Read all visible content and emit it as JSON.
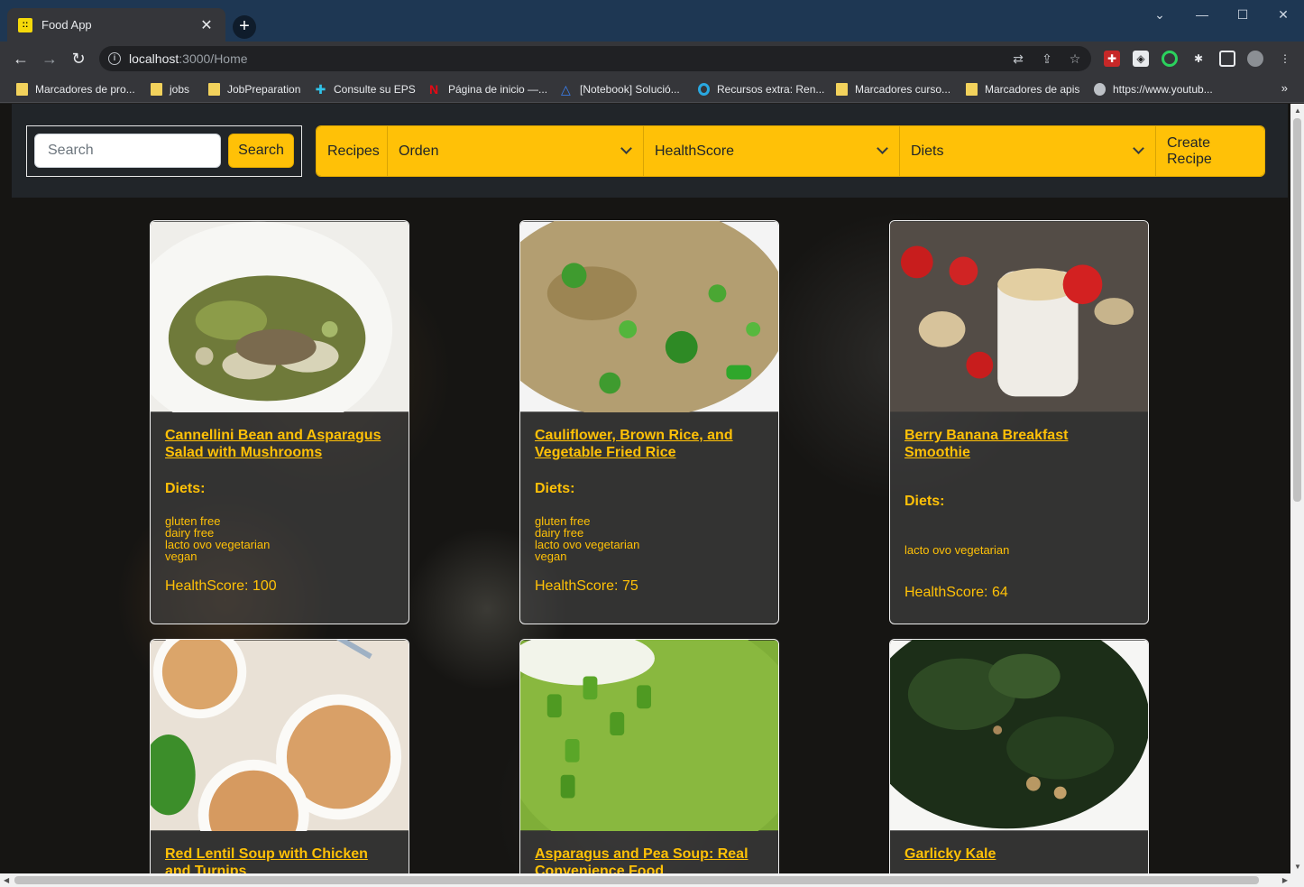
{
  "browser": {
    "tab_title": "Food App",
    "tab_favicon_glyph": "::",
    "url_host": "localhost",
    "url_rest": ":3000/Home",
    "new_tab_symbol": "+",
    "bookmarks": [
      {
        "label": "Marcadores de pro...",
        "icon": "folder-icon"
      },
      {
        "label": "jobs",
        "icon": "folder-icon"
      },
      {
        "label": "JobPreparation",
        "icon": "folder-icon"
      },
      {
        "label": "Consulte su EPS",
        "icon": "health-cross-icon"
      },
      {
        "label": "Página de inicio —...",
        "icon": "netflix-icon"
      },
      {
        "label": "[Notebook] Solució...",
        "icon": "triangle-icon"
      },
      {
        "label": "Recursos extra: Ren...",
        "icon": "ring-icon"
      },
      {
        "label": "Marcadores curso...",
        "icon": "folder-icon"
      },
      {
        "label": "Marcadores de apis",
        "icon": "folder-icon"
      },
      {
        "label": "https://www.youtub...",
        "icon": "globe-icon"
      }
    ]
  },
  "navbar": {
    "search_placeholder": "Search",
    "search_button": "Search",
    "recipes_label": "Recipes",
    "order_select": "Orden",
    "healthscore_select": "HealthScore",
    "diets_select": "Diets",
    "create_recipe": "Create Recipe"
  },
  "cards": [
    {
      "title": "Cannellini Bean and Asparagus Salad with Mushrooms",
      "diets_label": "Diets:",
      "diets": [
        "gluten free",
        "dairy free",
        "lacto ovo vegetarian",
        "vegan"
      ],
      "health_score": "HealthScore: 100"
    },
    {
      "title": "Cauliflower, Brown Rice, and Vegetable Fried Rice",
      "diets_label": "Diets:",
      "diets": [
        "gluten free",
        "dairy free",
        "lacto ovo vegetarian",
        "vegan"
      ],
      "health_score": "HealthScore: 75"
    },
    {
      "title": "Berry Banana Breakfast Smoothie",
      "diets_label": "Diets:",
      "diets": [
        "lacto ovo vegetarian"
      ],
      "health_score": "HealthScore: 64"
    },
    {
      "title": "Red Lentil Soup with Chicken and Turnips"
    },
    {
      "title": "Asparagus and Pea Soup: Real Convenience Food"
    },
    {
      "title": "Garlicky Kale"
    }
  ],
  "colors": {
    "accent": "#ffc107",
    "navbar_bg": "#212529",
    "chrome_tabbar": "#1e3753",
    "chrome_toolbar": "#35363a"
  }
}
